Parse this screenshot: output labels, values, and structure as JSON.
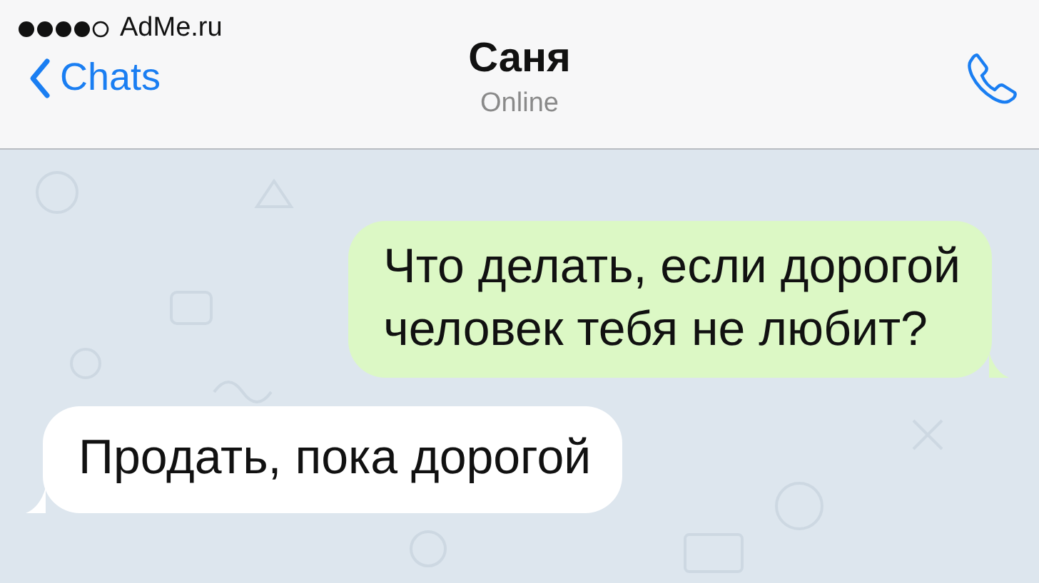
{
  "status_bar": {
    "carrier": "AdMe.ru"
  },
  "header": {
    "back_label": "Chats",
    "title": "Саня",
    "subtitle": "Online"
  },
  "messages": [
    {
      "kind": "outgoing",
      "lines": [
        "Что делать, если дорогой",
        "человек тебя не любит?"
      ]
    },
    {
      "kind": "incoming",
      "lines": [
        "Продать, пока дорогой"
      ]
    }
  ]
}
